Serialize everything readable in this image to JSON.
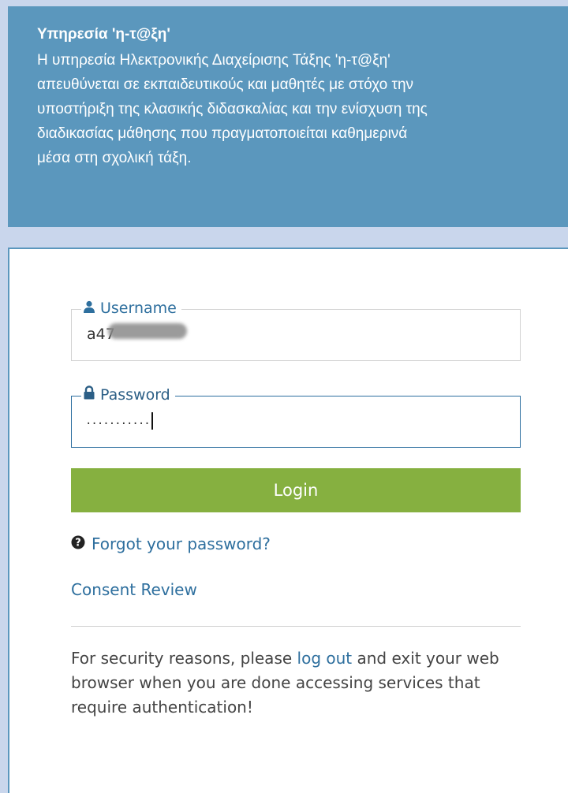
{
  "info": {
    "title": "Υπηρεσία 'η-τ@ξη'",
    "lines": [
      "Η υπηρεσία Ηλεκτρονικής Διαχείρισης Τάξης 'η-τ@ξη'",
      "απευθύνεται σε εκπαιδευτικούς και μαθητές με στόχο την",
      "υποστήριξη της κλασικής διδασκαλίας και την ενίσχυση της",
      "διαδικασίας μάθησης που πραγματοποιείται καθημερινά",
      "μέσα στη σχολική τάξη."
    ]
  },
  "login": {
    "username_label": "Username",
    "username_value": "a47",
    "password_label": "Password",
    "password_value": "...........",
    "button_label": "Login",
    "forgot_label": "Forgot your password?",
    "consent_label": "Consent Review",
    "notice_before": "For security reasons, please ",
    "notice_link": "log out",
    "notice_after": " and exit your web browser when you are done accessing services that require authentication!"
  },
  "colors": {
    "info_background": "#5b97bd",
    "button_background": "#86b040",
    "link": "#2e6f9e"
  },
  "icons": {
    "user": "user-icon",
    "lock": "lock-icon",
    "question": "question-circle-icon"
  }
}
